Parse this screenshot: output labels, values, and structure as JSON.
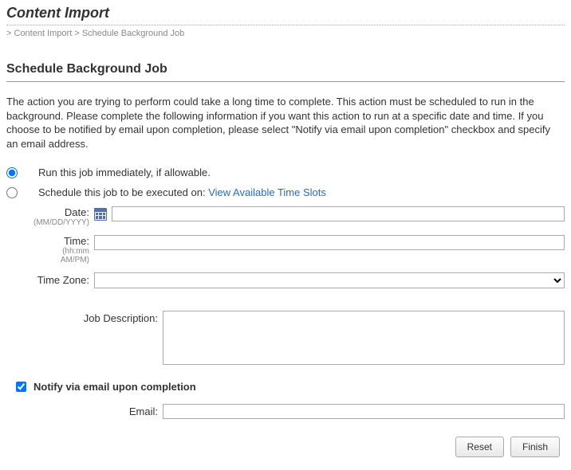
{
  "header": {
    "title": "Content Import"
  },
  "breadcrumb": {
    "prefix": ">",
    "item1": "Content Import",
    "sep": ">",
    "item2": "Schedule Background Job"
  },
  "section": {
    "title": "Schedule Background Job",
    "intro": "The action you are trying to perform could take a long time to complete. This action must be scheduled to run in the background. Please complete the following information if you want this action to run at a specific date and time. If you choose to be notified by email upon completion, please select \"Notify via email upon completion\" checkbox and specify an email address."
  },
  "options": {
    "immediate_label": "Run this job immediately, if allowable.",
    "schedule_label": "Schedule this job to be executed on:",
    "view_slots_link": "View Available Time Slots"
  },
  "form": {
    "date_label": "Date:",
    "date_hint": "(MM/DD/YYYY)",
    "date_value": "",
    "time_label": "Time:",
    "time_hint1": "(hh:mm",
    "time_hint2": "AM/PM)",
    "time_value": "",
    "tz_label": "Time Zone:",
    "tz_value": "",
    "desc_label": "Job Description:",
    "desc_value": "",
    "notify_label": "Notify via email upon completion",
    "notify_checked": true,
    "email_label": "Email:",
    "email_value": ""
  },
  "buttons": {
    "reset": "Reset",
    "finish": "Finish"
  }
}
